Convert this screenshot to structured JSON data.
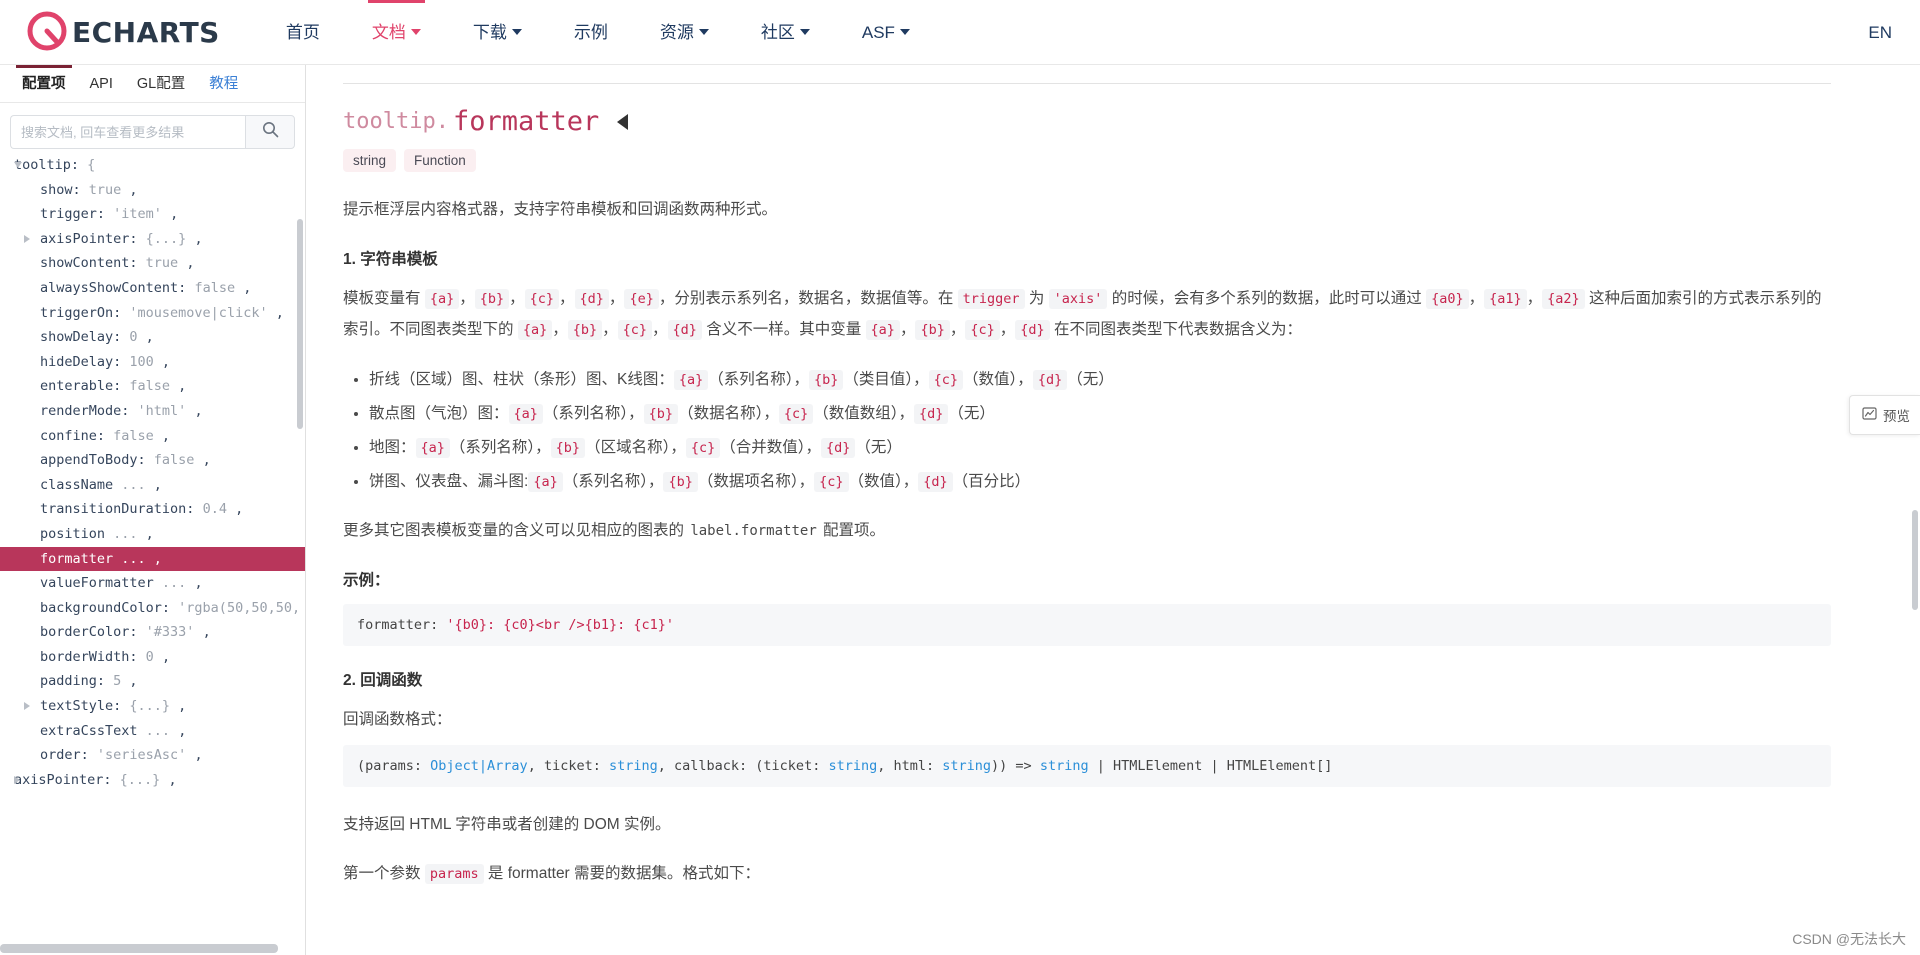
{
  "nav": {
    "brand": "ECHARTS",
    "items": [
      {
        "label": "首页",
        "caret": false,
        "active": false
      },
      {
        "label": "文档",
        "caret": true,
        "active": true
      },
      {
        "label": "下载",
        "caret": true,
        "active": false
      },
      {
        "label": "示例",
        "caret": false,
        "active": false
      },
      {
        "label": "资源",
        "caret": true,
        "active": false
      },
      {
        "label": "社区",
        "caret": true,
        "active": false
      },
      {
        "label": "ASF",
        "caret": true,
        "active": false
      }
    ],
    "lang": "EN"
  },
  "sidebar": {
    "tabs": [
      {
        "label": "配置项",
        "active": true,
        "link": false
      },
      {
        "label": "API",
        "active": false,
        "link": false
      },
      {
        "label": "GL配置",
        "active": false,
        "link": false
      },
      {
        "label": "教程",
        "active": false,
        "link": true
      }
    ],
    "search": {
      "placeholder": "搜索文档, 回车查看更多结果",
      "value": "",
      "icon": "search-icon"
    },
    "tree": [
      {
        "indent": 0,
        "arrow": "open",
        "key": "tooltip:",
        "value": "{",
        "selected": false
      },
      {
        "indent": 1,
        "arrow": "none",
        "key": "show:",
        "value": "true",
        "suffix": ",",
        "selected": false
      },
      {
        "indent": 1,
        "arrow": "none",
        "key": "trigger:",
        "value": "'item'",
        "suffix": ",",
        "selected": false
      },
      {
        "indent": 1,
        "arrow": "closed",
        "key": "axisPointer:",
        "value": "{...}",
        "suffix": ",",
        "selected": false
      },
      {
        "indent": 1,
        "arrow": "none",
        "key": "showContent:",
        "value": "true",
        "suffix": ",",
        "selected": false
      },
      {
        "indent": 1,
        "arrow": "none",
        "key": "alwaysShowContent:",
        "value": "false",
        "suffix": ",",
        "selected": false
      },
      {
        "indent": 1,
        "arrow": "none",
        "key": "triggerOn:",
        "value": "'mousemove|click'",
        "suffix": ",",
        "selected": false
      },
      {
        "indent": 1,
        "arrow": "none",
        "key": "showDelay:",
        "value": "0",
        "suffix": ",",
        "selected": false
      },
      {
        "indent": 1,
        "arrow": "none",
        "key": "hideDelay:",
        "value": "100",
        "suffix": ",",
        "selected": false
      },
      {
        "indent": 1,
        "arrow": "none",
        "key": "enterable:",
        "value": "false",
        "suffix": ",",
        "selected": false
      },
      {
        "indent": 1,
        "arrow": "none",
        "key": "renderMode:",
        "value": "'html'",
        "suffix": ",",
        "selected": false
      },
      {
        "indent": 1,
        "arrow": "none",
        "key": "confine:",
        "value": "false",
        "suffix": ",",
        "selected": false
      },
      {
        "indent": 1,
        "arrow": "none",
        "key": "appendToBody:",
        "value": "false",
        "suffix": ",",
        "selected": false
      },
      {
        "indent": 1,
        "arrow": "none",
        "key": "className",
        "value": "...",
        "suffix": ",",
        "selected": false
      },
      {
        "indent": 1,
        "arrow": "none",
        "key": "transitionDuration:",
        "value": "0.4",
        "suffix": ",",
        "selected": false
      },
      {
        "indent": 1,
        "arrow": "none",
        "key": "position",
        "value": "...",
        "suffix": ",",
        "selected": false
      },
      {
        "indent": 1,
        "arrow": "none",
        "key": "formatter",
        "value": "...",
        "suffix": ",",
        "selected": true
      },
      {
        "indent": 1,
        "arrow": "none",
        "key": "valueFormatter",
        "value": "...",
        "suffix": ",",
        "selected": false
      },
      {
        "indent": 1,
        "arrow": "none",
        "key": "backgroundColor:",
        "value": "'rgba(50,50,50,",
        "suffix": "",
        "selected": false
      },
      {
        "indent": 1,
        "arrow": "none",
        "key": "borderColor:",
        "value": "'#333'",
        "suffix": ",",
        "selected": false
      },
      {
        "indent": 1,
        "arrow": "none",
        "key": "borderWidth:",
        "value": "0",
        "suffix": ",",
        "selected": false
      },
      {
        "indent": 1,
        "arrow": "none",
        "key": "padding:",
        "value": "5",
        "suffix": ",",
        "selected": false
      },
      {
        "indent": 1,
        "arrow": "closed",
        "key": "textStyle:",
        "value": "{...}",
        "suffix": ",",
        "selected": false
      },
      {
        "indent": 1,
        "arrow": "none",
        "key": "extraCssText",
        "value": "...",
        "suffix": ",",
        "selected": false
      },
      {
        "indent": 1,
        "arrow": "none",
        "key": "order:",
        "value": "'seriesAsc'",
        "suffix": ",",
        "selected": false
      },
      {
        "indent": 0,
        "arrow": "closed",
        "key": "axisPointer:",
        "value": "{...}",
        "suffix": ",",
        "selected": false
      }
    ]
  },
  "doc": {
    "title_parent": "tooltip.",
    "title_leaf": "formatter",
    "badges": [
      "string",
      "Function"
    ],
    "intro": "提示框浮层内容格式器，支持字符串模板和回调函数两种形式。",
    "section1_heading": "1. 字符串模板",
    "p1_a": "模板变量有 ",
    "p1_vars": [
      "{a}",
      "{b}",
      "{c}",
      "{d}",
      "{e}"
    ],
    "p1_b": "，分别表示系列名，数据名，数据值等。在 ",
    "p1_trigger": "trigger",
    "p1_c": " 为 ",
    "p1_axis": "'axis'",
    "p1_d": " 的时候，会有多个系列的数据，此时可以通过 ",
    "p1_idxvars": [
      "{a0}",
      "{a1}",
      "{a2}"
    ],
    "p1_e": " 这种后面加索引的方式表示系列的索引。不同图表类型下的 ",
    "p1_vars2": [
      "{a}",
      "{b}",
      "{c}",
      "{d}"
    ],
    "p1_f": " 含义不一样。其中变量 ",
    "p1_vars3": [
      "{a}",
      "{b}",
      "{c}",
      "{d}"
    ],
    "p1_g": " 在不同图表类型下代表数据含义为：",
    "bullets": [
      {
        "prefix": "折线（区域）图、柱状（条形）图、K线图：",
        "parts": [
          {
            "code": "{a}",
            "text": "（系列名称），"
          },
          {
            "code": "{b}",
            "text": "（类目值），"
          },
          {
            "code": "{c}",
            "text": "（数值），"
          },
          {
            "code": "{d}",
            "text": "（无）"
          }
        ]
      },
      {
        "prefix": "散点图（气泡）图：",
        "parts": [
          {
            "code": "{a}",
            "text": "（系列名称），"
          },
          {
            "code": "{b}",
            "text": "（数据名称），"
          },
          {
            "code": "{c}",
            "text": "（数值数组），"
          },
          {
            "code": "{d}",
            "text": "（无）"
          }
        ]
      },
      {
        "prefix": "地图：",
        "parts": [
          {
            "code": "{a}",
            "text": "（系列名称），"
          },
          {
            "code": "{b}",
            "text": "（区域名称），"
          },
          {
            "code": "{c}",
            "text": "（合并数值），"
          },
          {
            "code": "{d}",
            "text": "（无）"
          }
        ]
      },
      {
        "prefix": "饼图、仪表盘、漏斗图:",
        "parts": [
          {
            "code": "{a}",
            "text": "（系列名称），"
          },
          {
            "code": "{b}",
            "text": "（数据项名称），"
          },
          {
            "code": "{c}",
            "text": "（数值），"
          },
          {
            "code": "{d}",
            "text": "（百分比）"
          }
        ]
      }
    ],
    "p2_a": "更多其它图表模板变量的含义可以见相应的图表的 ",
    "p2_code": "label.formatter",
    "p2_b": " 配置项。",
    "example_heading": "示例：",
    "code_example": "formatter: '{b0}: {c0}<br />{b1}: {c1}'",
    "code_example_pre": "formatter: ",
    "code_example_str": "'{b0}: {c0}<br />{b1}: {c1}'",
    "section2_heading": "2. 回调函数",
    "p3": "回调函数格式：",
    "code_signature_parts": [
      {
        "t": "(params: ",
        "k": "plain"
      },
      {
        "t": "Object|Array",
        "k": "type"
      },
      {
        "t": ", ticket: ",
        "k": "plain"
      },
      {
        "t": "string",
        "k": "type"
      },
      {
        "t": ", callback: (ticket: ",
        "k": "plain"
      },
      {
        "t": "string",
        "k": "type"
      },
      {
        "t": ", html: ",
        "k": "plain"
      },
      {
        "t": "string",
        "k": "type"
      },
      {
        "t": ")) => ",
        "k": "plain"
      },
      {
        "t": "string",
        "k": "type"
      },
      {
        "t": " | HTMLElement | HTMLElement[]",
        "k": "plain"
      }
    ],
    "p4": "支持返回 HTML 字符串或者创建的 DOM 实例。",
    "p5_a": "第一个参数 ",
    "p5_code": "params",
    "p5_b": " 是 formatter 需要的数据集。格式如下："
  },
  "preview": {
    "label": "预览",
    "icon": "preview-icon"
  },
  "watermark": "CSDN @无法长大",
  "colors": {
    "accent": "#b8365b",
    "nav_active": "#e0436b",
    "code_pink": "#c7254e",
    "type_blue": "#2b8fd8",
    "tab_underline": "#7a2234"
  }
}
